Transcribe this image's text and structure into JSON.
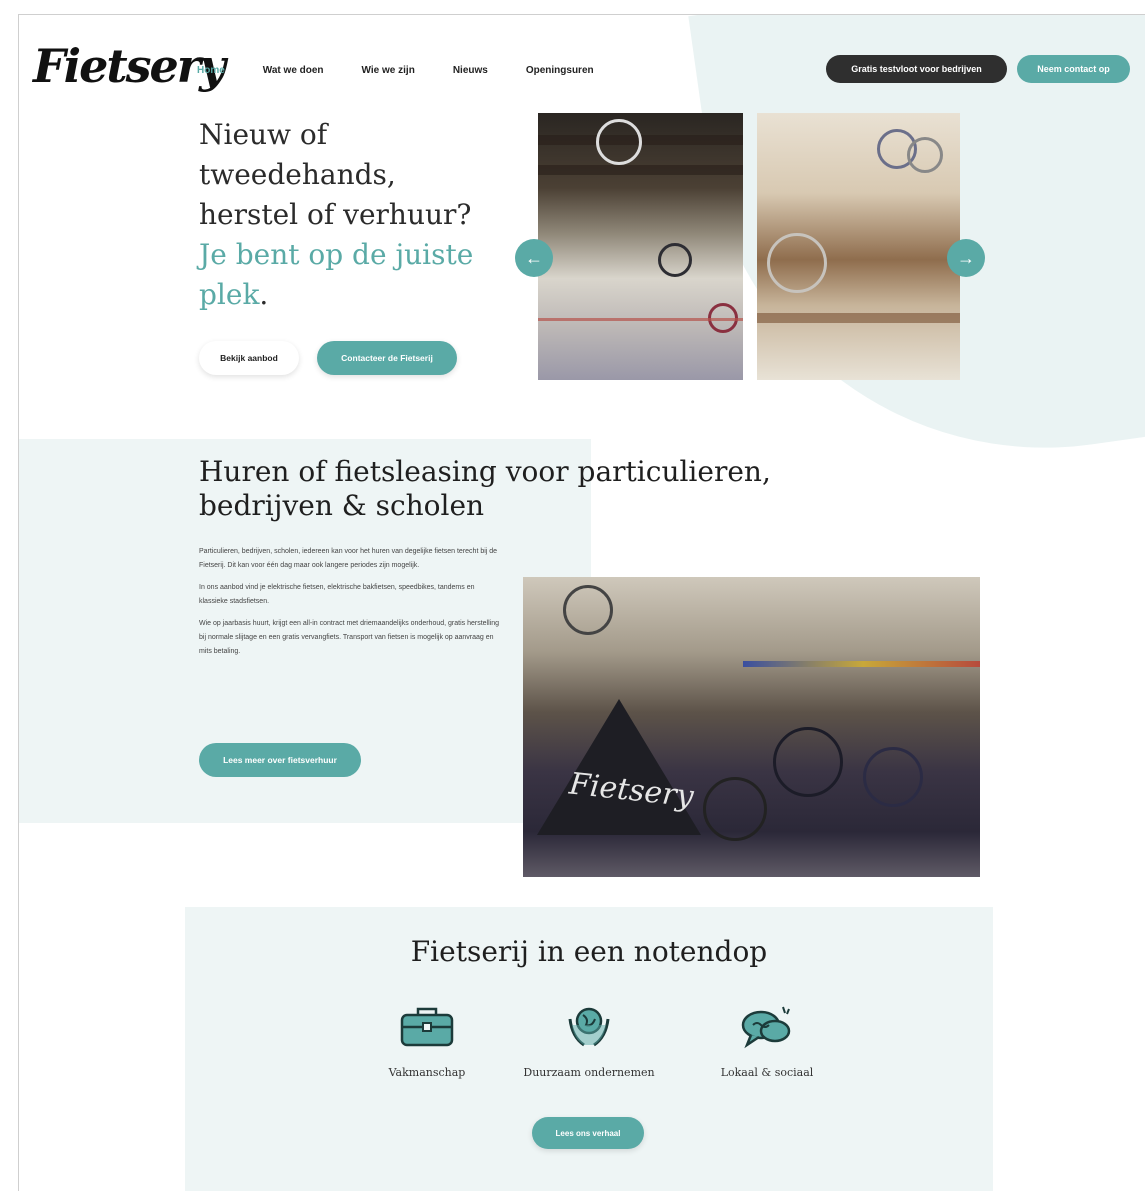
{
  "brand": {
    "logo_text": "Fietsery",
    "accent_color": "#5aaaa6",
    "dark_color": "#2f2f2f"
  },
  "nav": {
    "items": [
      "Home",
      "Wat we doen",
      "Wie we zijn",
      "Nieuws",
      "Openingsuren"
    ],
    "active": "Home"
  },
  "header_buttons": {
    "test_fleet": "Gratis testvloot voor bedrijven",
    "contact": "Neem contact op"
  },
  "hero": {
    "title_line1": "Nieuw of",
    "title_line2": "tweedehands,",
    "title_line3": "herstel of verhuur?",
    "accent_line1": "Je bent op de juiste",
    "accent_line2": "plek",
    "period": ".",
    "button_offer": "Bekijk aanbod",
    "button_contact": "Contacteer de Fietserij",
    "prev_icon": "arrow-left-icon",
    "next_icon": "arrow-right-icon"
  },
  "rental": {
    "title_line1": "Huren of fietsleasing voor particulieren,",
    "title_line2": "bedrijven & scholen",
    "paragraphs": [
      "Particulieren, bedrijven, scholen, iedereen kan voor het huren van degelijke fietsen terecht bij de Fietserij. Dit kan voor één dag maar ook langere periodes zijn mogelijk.",
      "In ons aanbod vind je elektrische fietsen, elektrische bakfietsen, speedbikes, tandems en klassieke stadsfietsen.",
      "Wie op jaarbasis huurt, krijgt een all-in contract met driemaandelijks onderhoud, gratis herstelling bij normale slijtage en een gratis vervangfiets. Transport van fietsen is mogelijk op aanvraag en mits betaling."
    ],
    "button": "Lees meer over fietsverhuur",
    "photo_logo": "Fietsery"
  },
  "nutshell": {
    "title": "Fietserij in een notendop",
    "features": [
      {
        "label": "Vakmanschap",
        "icon": "toolbox-icon"
      },
      {
        "label": "Duurzaam ondernemen",
        "icon": "hands-globe-icon"
      },
      {
        "label": "Lokaal & sociaal",
        "icon": "chat-bubbles-icon"
      }
    ],
    "button": "Lees ons verhaal"
  }
}
